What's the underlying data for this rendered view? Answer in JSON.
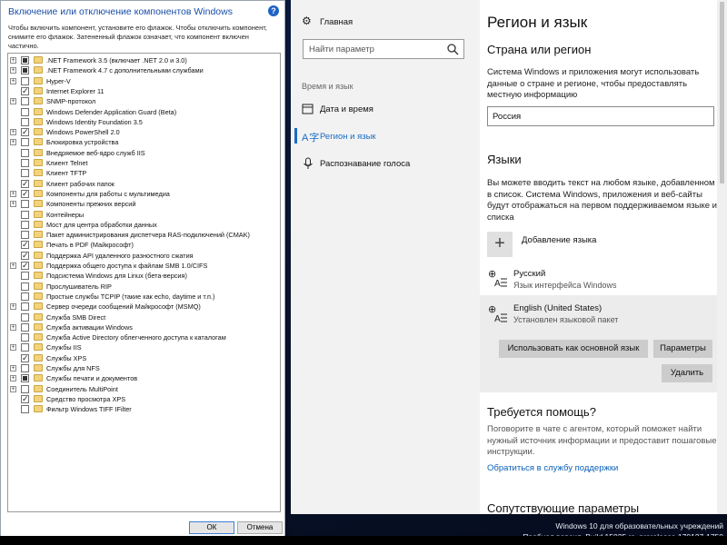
{
  "features_dialog": {
    "title": "Включение или отключение компонентов Windows",
    "description": "Чтобы включить компонент, установите его флажок. Чтобы отключить компонент, снимите его флажок. Затененный флажок означает, что компонент включен частично.",
    "items": [
      {
        "label": ".NET Framework 3.5 (включает .NET 2.0 и 3.0)",
        "expandable": true,
        "state": "partial"
      },
      {
        "label": ".NET Framework 4.7 с дополнительными службами",
        "expandable": true,
        "state": "partial"
      },
      {
        "label": "Hyper-V",
        "expandable": true,
        "state": "unchecked"
      },
      {
        "label": "Internet Explorer 11",
        "expandable": false,
        "state": "checked"
      },
      {
        "label": "SNMP-протокол",
        "expandable": true,
        "state": "unchecked"
      },
      {
        "label": "Windows Defender Application Guard (Beta)",
        "expandable": false,
        "state": "unchecked"
      },
      {
        "label": "Windows Identity Foundation 3.5",
        "expandable": false,
        "state": "unchecked"
      },
      {
        "label": "Windows PowerShell 2.0",
        "expandable": true,
        "state": "checked"
      },
      {
        "label": "Блокировка устройства",
        "expandable": true,
        "state": "unchecked"
      },
      {
        "label": "Внедряемое веб-ядро служб IIS",
        "expandable": false,
        "state": "unchecked"
      },
      {
        "label": "Клиент Telnet",
        "expandable": false,
        "state": "unchecked"
      },
      {
        "label": "Клиент TFTP",
        "expandable": false,
        "state": "unchecked"
      },
      {
        "label": "Клиент рабочих папок",
        "expandable": false,
        "state": "checked"
      },
      {
        "label": "Компоненты для работы с мультимедиа",
        "expandable": true,
        "state": "checked"
      },
      {
        "label": "Компоненты прежних версий",
        "expandable": true,
        "state": "unchecked"
      },
      {
        "label": "Контейнеры",
        "expandable": false,
        "state": "unchecked"
      },
      {
        "label": "Мост для центра обработки данных",
        "expandable": false,
        "state": "unchecked"
      },
      {
        "label": "Пакет администрирования диспетчера RAS-подключений (CMAK)",
        "expandable": false,
        "state": "unchecked"
      },
      {
        "label": "Печать в PDF (Майкрософт)",
        "expandable": false,
        "state": "checked"
      },
      {
        "label": "Поддержка API удаленного разностного сжатия",
        "expandable": false,
        "state": "checked"
      },
      {
        "label": "Поддержка общего доступа к файлам SMB 1.0/CIFS",
        "expandable": true,
        "state": "checked"
      },
      {
        "label": "Подсистема Windows для Linux (бета-версия)",
        "expandable": false,
        "state": "unchecked"
      },
      {
        "label": "Прослушиватель RIP",
        "expandable": false,
        "state": "unchecked"
      },
      {
        "label": "Простые службы TCPIP (такие как echo, daytime и т.п.)",
        "expandable": false,
        "state": "unchecked"
      },
      {
        "label": "Сервер очереди сообщений Майкрософт (MSMQ)",
        "expandable": true,
        "state": "unchecked"
      },
      {
        "label": "Служба SMB Direct",
        "expandable": false,
        "state": "unchecked"
      },
      {
        "label": "Служба активации Windows",
        "expandable": true,
        "state": "unchecked"
      },
      {
        "label": "Служба Active Directory облегченного доступа к каталогам",
        "expandable": false,
        "state": "unchecked"
      },
      {
        "label": "Службы IIS",
        "expandable": true,
        "state": "unchecked"
      },
      {
        "label": "Службы XPS",
        "expandable": false,
        "state": "checked"
      },
      {
        "label": "Службы для NFS",
        "expandable": true,
        "state": "unchecked"
      },
      {
        "label": "Службы печати и документов",
        "expandable": true,
        "state": "partial"
      },
      {
        "label": "Соединитель MultiPoint",
        "expandable": true,
        "state": "unchecked"
      },
      {
        "label": "Средство просмотра XPS",
        "expandable": false,
        "state": "checked"
      },
      {
        "label": "Фильтр Windows TIFF IFilter",
        "expandable": false,
        "state": "unchecked"
      }
    ],
    "ok_label": "ОК",
    "cancel_label": "Отмена"
  },
  "settings": {
    "nav": {
      "home": "Главная",
      "search_placeholder": "Найти параметр",
      "section": "Время и язык",
      "items": [
        "Дата и время",
        "Регион и язык",
        "Распознавание голоса"
      ],
      "active_index": 1
    },
    "main": {
      "title": "Регион и язык",
      "country_heading": "Страна или регион",
      "country_text": "Система Windows и приложения могут использовать данные о стране и регионе, чтобы предоставлять местную информацию",
      "country_value": "Россия",
      "languages_heading": "Языки",
      "languages_text": "Вы можете вводить текст на любом языке, добавленном в список. Система Windows, приложения и веб-сайты будут отображаться на первом поддерживаемом языке из списка",
      "add_language": "Добавление языка",
      "languages": [
        {
          "name": "Русский",
          "status": "Язык интерфейса Windows"
        },
        {
          "name": "English (United States)",
          "status": "Установлен языковой пакет"
        }
      ],
      "btn_set_default": "Использовать как основной язык",
      "btn_options": "Параметры",
      "btn_remove": "Удалить",
      "help_heading": "Требуется помощь?",
      "help_text": "Поговорите в чате с агентом, который поможет найти нужный источник информации и предоставит пошаговые инструкции.",
      "help_link": "Обратиться в службу поддержки",
      "related_heading": "Сопутствующие параметры"
    }
  },
  "watermark": {
    "line1": "Windows 10 для образовательных учреждений",
    "line2": "Пробная версия. Build 15025.rs_prerelease.170127-1750"
  }
}
